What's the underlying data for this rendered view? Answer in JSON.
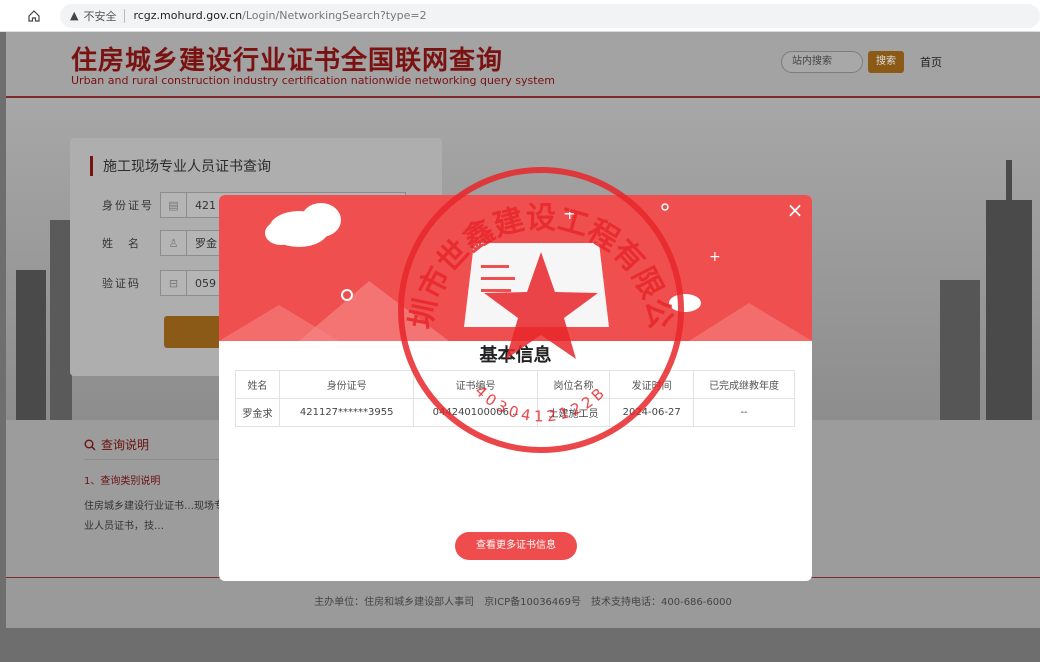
{
  "browser": {
    "security_icon": "warning-triangle-icon",
    "security_text": "不安全",
    "url_host": "rcgz.mohurd.gov.cn",
    "url_path": "/Login/NetworkingSearch?type=2"
  },
  "header": {
    "title": "住房城乡建设行业证书全国联网查询",
    "subtitle": "Urban and rural construction industry certification nationwide networking query system",
    "search_placeholder": "站内搜索",
    "search_button": "搜索",
    "home_link": "首页"
  },
  "form": {
    "title": "施工现场专业人员证书查询",
    "fields": [
      {
        "label": "身份证号",
        "value": "421",
        "icon": "id-card-icon"
      },
      {
        "label": "姓　名",
        "value": "罗金",
        "icon": "user-icon"
      },
      {
        "label": "验证码",
        "value": "059",
        "icon": "captcha-icon"
      }
    ]
  },
  "notice": {
    "title": "查询说明",
    "subtitle": "1、查询类别说明",
    "text": "住房城乡建设行业证书…现场专业人员证书，技…"
  },
  "footer": {
    "text": "主办单位：住房和城乡建设部人事司　京ICP备10036469号　技术支持电话：400-686-6000"
  },
  "modal": {
    "title": "基本信息",
    "close_label": "×",
    "columns": [
      "姓名",
      "身份证号",
      "证书编号",
      "岗位名称",
      "发证时间",
      "已完成继教年度"
    ],
    "rows": [
      [
        "罗金求",
        "421127******3955",
        "044240100006...",
        "土建施工员",
        "2024-06-27",
        "--"
      ]
    ],
    "more_button": "查看更多证书信息"
  },
  "stamp": {
    "company_text": "深圳市世鑫建设工程有限公司",
    "number_text": "4030412122B",
    "color": "#e8262b"
  },
  "colors": {
    "banner_red": "#f04f4f",
    "accent_red": "#ef4d4d",
    "brand_dark_red": "#7a1212"
  }
}
